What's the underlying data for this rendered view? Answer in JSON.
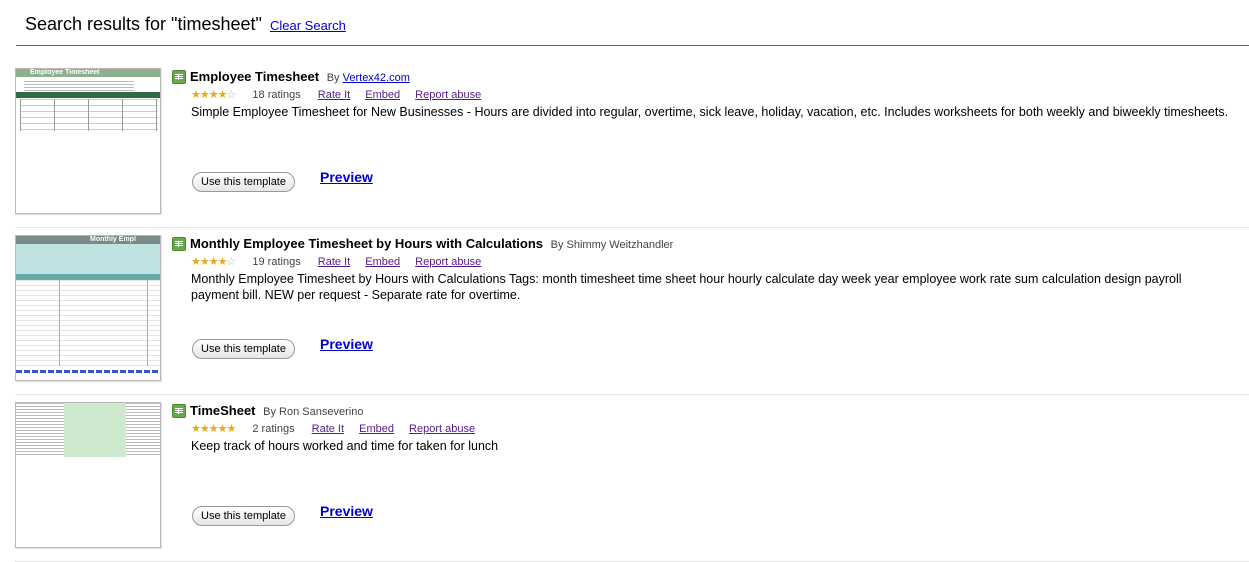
{
  "header": {
    "title": "Search results for \"timesheet\"",
    "clear_search": "Clear Search"
  },
  "results": [
    {
      "title": "Employee Timesheet",
      "by": "By",
      "author": "Vertex42.com",
      "author_is_link": true,
      "stars_filled": 3.5,
      "ratings": "18 ratings",
      "rate_it": "Rate It",
      "embed": "Embed",
      "report": "Report abuse",
      "description": "Simple Employee Timesheet for New Businesses - Hours are divided into regular, overtime, sick leave, holiday, vacation, etc. Includes worksheets for both weekly and biweekly timesheets.",
      "use_button": "Use this template",
      "preview": "Preview"
    },
    {
      "title": "Monthly Employee Timesheet by Hours with Calculations",
      "by": "By",
      "author": "Shimmy Weitzhandler",
      "author_is_link": false,
      "stars_filled": 4,
      "ratings": "19 ratings",
      "rate_it": "Rate It",
      "embed": "Embed",
      "report": "Report abuse",
      "description": "Monthly Employee Timesheet by Hours with Calculations Tags: month timesheet time sheet hour hourly calculate day week year employee work rate sum calculation design payroll payment bill. NEW per request - Separate rate for overtime.",
      "use_button": "Use this template",
      "preview": "Preview"
    },
    {
      "title": "TimeSheet",
      "by": "By",
      "author": "Ron Sanseverino",
      "author_is_link": false,
      "stars_filled": 5,
      "ratings": "2 ratings",
      "rate_it": "Rate It",
      "embed": "Embed",
      "report": "Report abuse",
      "description": "Keep track of hours worked and time for taken for lunch",
      "use_button": "Use this template",
      "preview": "Preview"
    }
  ],
  "thumbnails": {
    "t1_heading": "Employee Timesheet",
    "t2_heading": "Monthly Empl"
  },
  "icons": {
    "sheet": "spreadsheet-icon",
    "star": "star-icon"
  },
  "colors": {
    "link": "#0000cc",
    "visited": "#551a8b",
    "rule": "#3366cc",
    "star": "#e8a817",
    "sheet_icon": "#6aa84f"
  }
}
